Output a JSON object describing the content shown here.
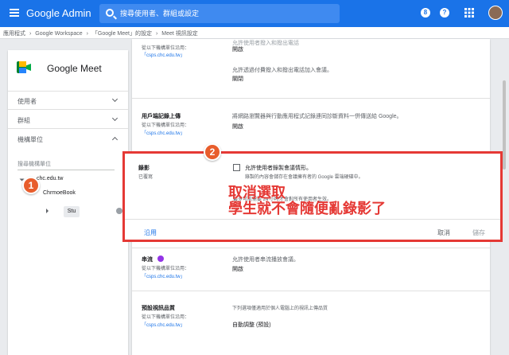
{
  "topbar": {
    "brand": "Google Admin",
    "search_placeholder": "搜尋使用者、群組或設定",
    "icon_badge": "8",
    "icon_help": "?"
  },
  "breadcrumb": [
    "應用程式",
    "›",
    "Google Workspace",
    "›",
    "「Google Meet」的設定",
    "›",
    "Meet 視訊設定"
  ],
  "sidebar": {
    "app_title": "Google Meet",
    "items": [
      {
        "label": "使用者"
      },
      {
        "label": "群組"
      },
      {
        "label": "機構單位"
      }
    ],
    "org_search_placeholder": "搜尋機構單位",
    "tree": {
      "root": "chc.edu.tw",
      "child": "ChrmoeBook",
      "grandchild": "Stu"
    }
  },
  "sections": {
    "s0": {
      "inherit": "從以下機構單位沿用：",
      "inherit_link": "「csps.chc.edu.tw」",
      "desc_top": "允許使用者撥入和撥出電話",
      "value_1": "開啟",
      "desc_2": "允許透過付費撥入和撥出電話加入會議。",
      "value_2": "關閉"
    },
    "s1": {
      "title": "用戶端記錄上傳",
      "inherit": "從以下機構單位沿用：",
      "inherit_link": "「csps.chc.edu.tw」",
      "desc": "將網路瀏覽器與行動應用程式記錄連同診斷資料一併傳送給 Google。",
      "value": "開啟"
    },
    "recording": {
      "title": "錄影",
      "status": "已覆寫",
      "checkbox_label": "允許使用者錄製會議情形。",
      "checkbox_sub": "錄製的內容會儲存在會議擁有者的 Google 雲端硬碟中。",
      "note": "最多可能需要 24 小時才會對所有使用者生效。",
      "annotation_1": "取消選取",
      "annotation_2": "學生就不會隨便亂錄影了",
      "apply": "沿用",
      "cancel": "取消",
      "save": "儲存"
    },
    "streaming": {
      "title": "串流",
      "inherit": "從以下機構單位沿用：",
      "inherit_link": "「csps.chc.edu.tw」",
      "desc": "允許使用者串流播放會議。",
      "value": "開啟"
    },
    "quality": {
      "title": "預設視訊品質",
      "inherit": "從以下機構單位沿用：",
      "inherit_link": "「csps.chc.edu.tw」",
      "desc": "下列選項僅適用於個人電腦上的視訊上傳品質",
      "value": "自動調整 (預設)"
    }
  },
  "markers": {
    "one": "1",
    "two": "2"
  },
  "colors": {
    "topbar": "#1a73e8",
    "annotation": "#e53935",
    "marker": "#e85d2c",
    "link": "#1a73e8"
  }
}
